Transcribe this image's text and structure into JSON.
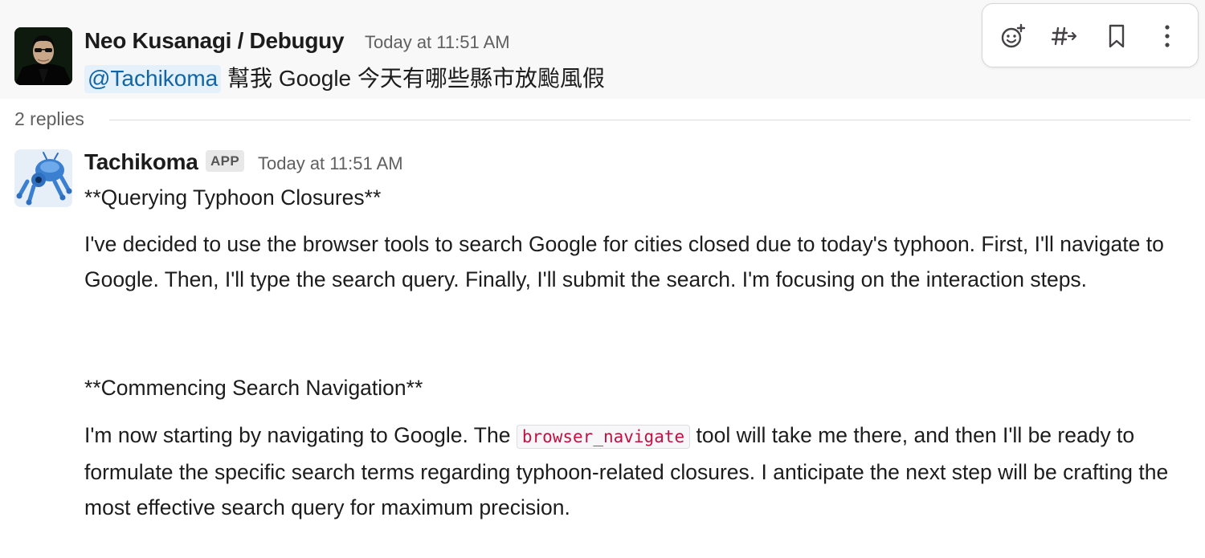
{
  "parent_message": {
    "sender": "Neo Kusanagi / Debuguy",
    "timestamp": "Today at 11:51 AM",
    "mention": "@Tachikoma",
    "text": " 幫我 Google 今天有哪些縣市放颱風假"
  },
  "toolbar": {
    "icons": [
      "add-reaction-icon",
      "reply-in-channel-icon",
      "bookmark-icon",
      "more-actions-icon"
    ]
  },
  "thread": {
    "replies_label": "2 replies"
  },
  "reply": {
    "sender": "Tachikoma",
    "badge": "APP",
    "timestamp": "Today at 11:51 AM",
    "heading1": "**Querying Typhoon Closures**",
    "para1": "I've decided to use the browser tools to search Google for cities closed due to today's typhoon. First, I'll navigate to Google. Then, I'll type the search query. Finally, I'll submit the search. I'm focusing on the interaction steps.",
    "heading2": "**Commencing Search Navigation**",
    "para2_before": "I'm now starting by navigating to Google. The ",
    "para2_code": "browser_navigate",
    "para2_after": " tool will take me there, and then I'll be ready to formulate the specific search terms regarding typhoon-related closures. I anticipate the next step will be crafting the most effective search query for maximum precision."
  },
  "colors": {
    "mention_bg": "#e4f1fb",
    "mention_text": "#1264a3",
    "code_text": "#c01343",
    "muted_text": "#616061"
  }
}
